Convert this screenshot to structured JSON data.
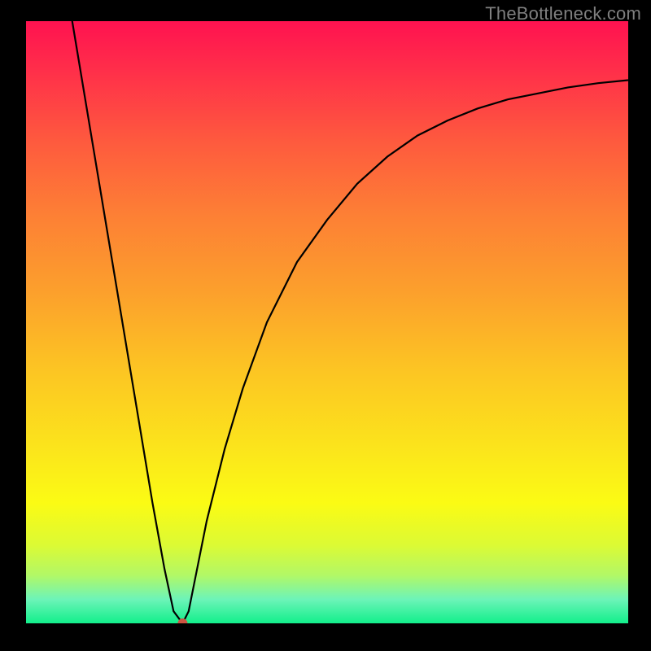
{
  "watermark": "TheBottleneck.com",
  "chart_data": {
    "type": "line",
    "title": "",
    "xlabel": "",
    "ylabel": "",
    "xlim": [
      0,
      100
    ],
    "ylim": [
      0,
      100
    ],
    "grid": false,
    "legend": false,
    "background_gradient": {
      "top_color": "#ff1250",
      "mid_color": "#fcc523",
      "bottom_color": "#12ef8b"
    },
    "series": [
      {
        "name": "bottleneck-curve",
        "color": "#000000",
        "x": [
          5,
          7,
          9,
          11,
          13,
          15,
          17,
          19,
          21,
          23,
          24.5,
          26,
          27,
          28,
          30,
          33,
          36,
          40,
          45,
          50,
          55,
          60,
          65,
          70,
          75,
          80,
          85,
          90,
          95,
          100
        ],
        "y": [
          113,
          104,
          92,
          80,
          68,
          56,
          44,
          32,
          20,
          9,
          2,
          0,
          2,
          7,
          17,
          29,
          39,
          50,
          60,
          67,
          73,
          77.5,
          81,
          83.5,
          85.5,
          87,
          88,
          89,
          89.7,
          90.2
        ]
      }
    ],
    "marker": {
      "name": "optimal-point",
      "x": 26,
      "y": 0,
      "color": "#cc5542"
    }
  }
}
